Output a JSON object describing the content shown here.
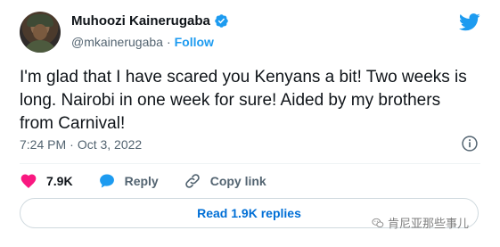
{
  "author": {
    "display_name": "Muhoozi Kainerugaba",
    "handle": "@mkainerugaba",
    "separator": "·",
    "follow_label": "Follow"
  },
  "tweet": {
    "text": "I'm glad that I have scared you Kenyans a bit! Two weeks is long. Nairobi in one week for sure! Aided by my brothers from Carnival!",
    "time": "7:24 PM",
    "meta_separator": "·",
    "date": "Oct 3, 2022"
  },
  "actions": {
    "likes": "7.9K",
    "reply_label": "Reply",
    "copy_link_label": "Copy link"
  },
  "replies_button_label": "Read 1.9K replies",
  "watermark_text": "肯尼亚那些事儿",
  "colors": {
    "twitter_blue": "#1d9bf0",
    "like_pink": "#f91880",
    "text_dark": "#0f1419",
    "text_muted": "#536471"
  },
  "icons": [
    "verified-badge-icon",
    "twitter-bird-icon",
    "info-icon",
    "heart-icon",
    "reply-icon",
    "link-icon",
    "wechat-icon"
  ]
}
